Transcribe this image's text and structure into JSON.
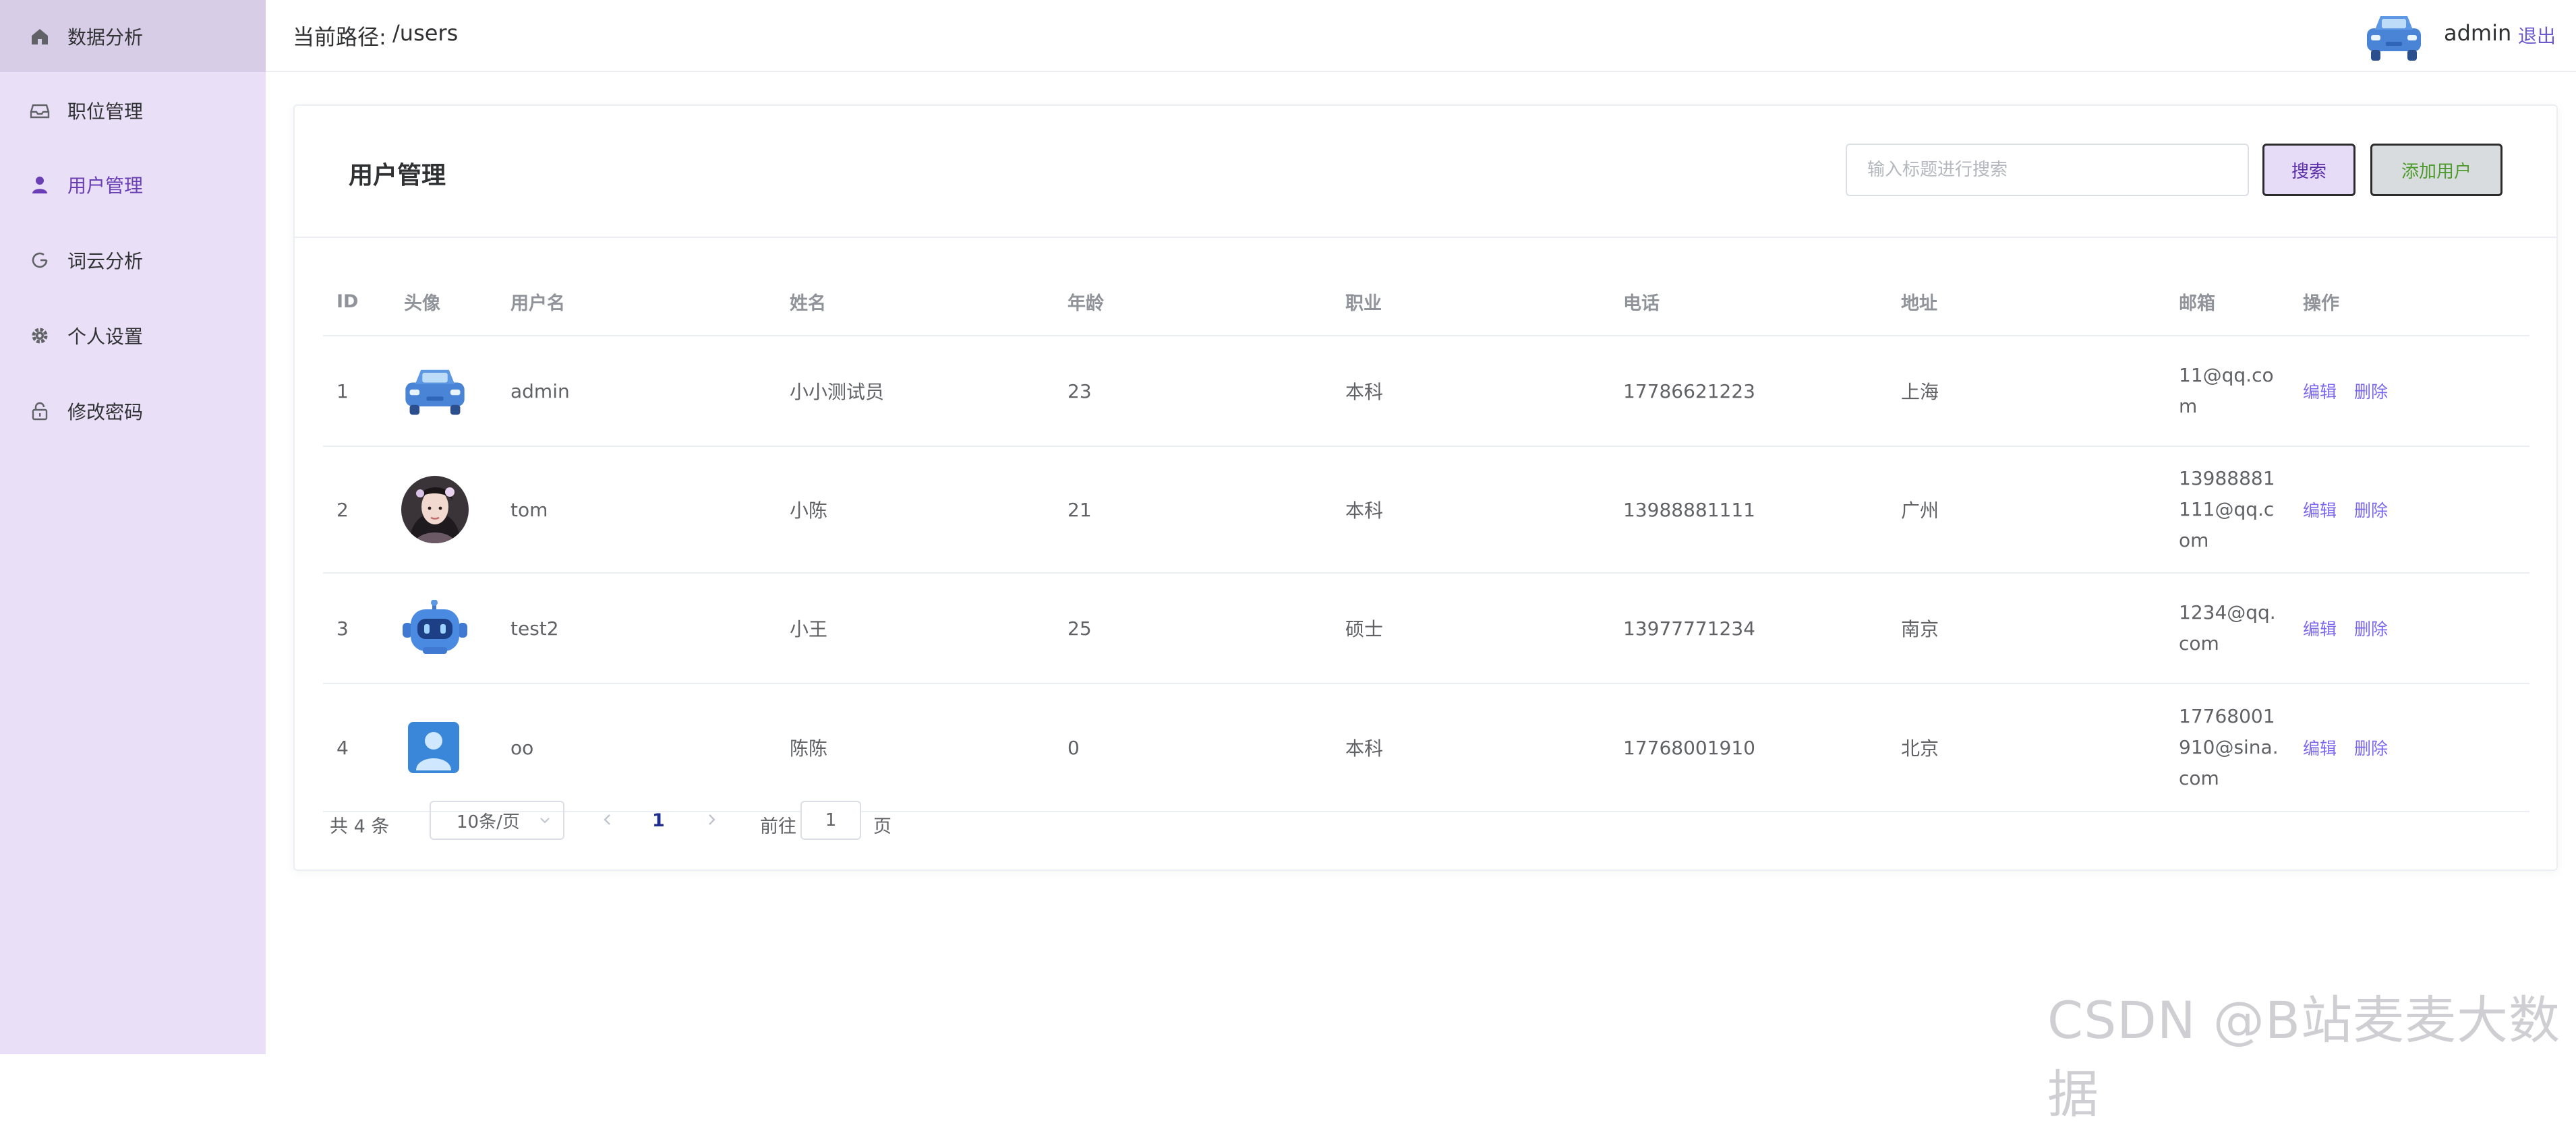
{
  "sidebar": {
    "items": [
      {
        "label": "数据分析",
        "icon": "home-icon"
      },
      {
        "label": "职位管理",
        "icon": "inbox-icon"
      },
      {
        "label": "用户管理",
        "icon": "user-icon"
      },
      {
        "label": "词云分析",
        "icon": "refresh-icon"
      },
      {
        "label": "个人设置",
        "icon": "gear-icon"
      },
      {
        "label": "修改密码",
        "icon": "lock-icon"
      }
    ],
    "active_index": 2,
    "colors": {
      "background": "#e9dff7",
      "hover": "#d7cde7",
      "active_text": "#6a3fb5"
    }
  },
  "header": {
    "path_prefix": "当前路径:",
    "path_value": "/users",
    "username": "admin",
    "logout_label": "退出"
  },
  "card": {
    "title": "用户管理",
    "search": {
      "placeholder": "输入标题进行搜索",
      "value": ""
    },
    "search_button": "搜索",
    "add_button": "添加用户"
  },
  "table": {
    "columns": [
      "ID",
      "头像",
      "用户名",
      "姓名",
      "年龄",
      "职业",
      "电话",
      "地址",
      "邮箱",
      "操作"
    ],
    "rows": [
      {
        "id": "1",
        "avatar": "car-avatar",
        "username": "admin",
        "name": "小小测试员",
        "age": "23",
        "job": "本科",
        "phone": "17786621223",
        "address": "上海",
        "email": "11@qq.com"
      },
      {
        "id": "2",
        "avatar": "photo-avatar",
        "username": "tom",
        "name": "小陈",
        "age": "21",
        "job": "本科",
        "phone": "13988881111",
        "address": "广州",
        "email": "13988881111@qq.com"
      },
      {
        "id": "3",
        "avatar": "robot-avatar",
        "username": "test2",
        "name": "小王",
        "age": "25",
        "job": "硕士",
        "phone": "13977771234",
        "address": "南京",
        "email": "1234@qq.com"
      },
      {
        "id": "4",
        "avatar": "person-avatar",
        "username": "oo",
        "name": "陈陈",
        "age": "0",
        "job": "本科",
        "phone": "17768001910",
        "address": "北京",
        "email": "17768001910@sina.com"
      }
    ],
    "edit_label": "编辑",
    "delete_label": "删除"
  },
  "pagination": {
    "total_label": "共 4 条",
    "page_size_label": "10条/页",
    "current_page": "1",
    "goto_label": "前往",
    "goto_value": "1",
    "page_suffix": "页"
  },
  "watermark": "CSDN @B站麦麦大数据"
}
